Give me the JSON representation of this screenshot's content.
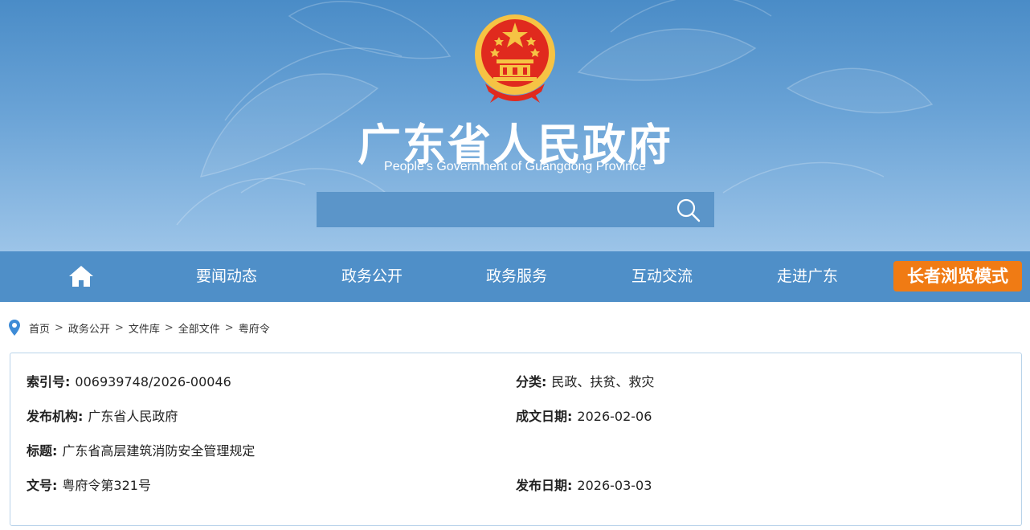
{
  "header": {
    "title": "广东省人民政府",
    "subtitle": "People's Government of Guangdong Province",
    "search_placeholder": ""
  },
  "nav": {
    "items": [
      "要闻动态",
      "政务公开",
      "政务服务",
      "互动交流",
      "走进广东"
    ],
    "elder_mode": "长者浏览模式"
  },
  "breadcrumb": [
    "首页",
    "政务公开",
    "文件库",
    "全部文件",
    "粤府令"
  ],
  "info": {
    "index_label": "索引号:",
    "index_value": "006939748/2026-00046",
    "category_label": "分类:",
    "category_value": "民政、扶贫、救灾",
    "publisher_label": "发布机构:",
    "publisher_value": "广东省人民政府",
    "written_date_label": "成文日期:",
    "written_date_value": "2026-02-06",
    "title_label": "标题:",
    "title_value": "广东省高层建筑消防安全管理规定",
    "docno_label": "文号:",
    "docno_value": "粤府令第321号",
    "publish_date_label": "发布日期:",
    "publish_date_value": "2026-03-03"
  },
  "colors": {
    "banner_top": "#4a8cc7",
    "nav_bg": "#4f8fc8",
    "elder_bg": "#f07b14",
    "emblem_red": "#e02a1e",
    "emblem_gold": "#f6c344"
  }
}
